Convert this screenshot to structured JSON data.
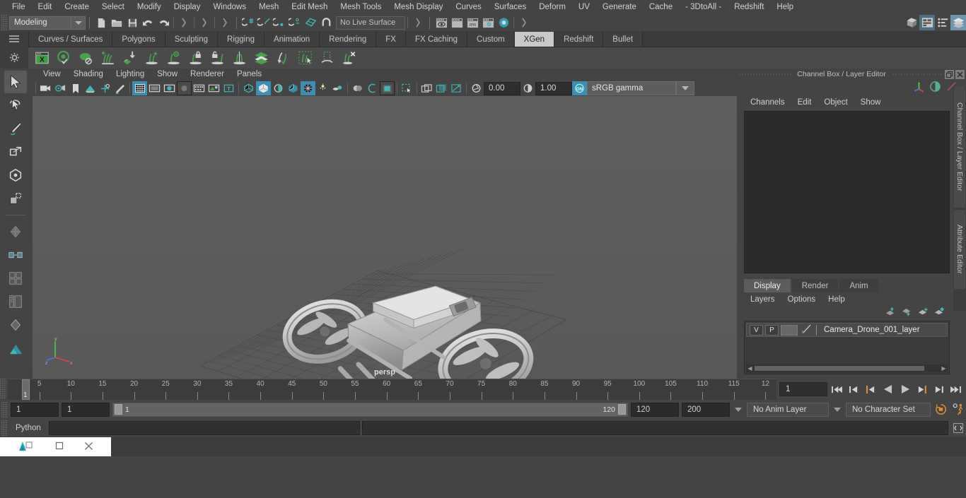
{
  "menubar": {
    "items": [
      "File",
      "Edit",
      "Create",
      "Select",
      "Modify",
      "Display",
      "Windows",
      "Mesh",
      "Edit Mesh",
      "Mesh Tools",
      "Mesh Display",
      "Curves",
      "Surfaces",
      "Deform",
      "UV",
      "Generate",
      "Cache",
      "- 3DtoAll -",
      "Redshift",
      "Help"
    ]
  },
  "statusline": {
    "mode": "Modeling",
    "live_surface": "No Live Surface",
    "num1": "0.00",
    "num2": "1.00",
    "colorspace": "sRGB gamma"
  },
  "shelf": {
    "tabs": [
      "Curves / Surfaces",
      "Polygons",
      "Sculpting",
      "Rigging",
      "Animation",
      "Rendering",
      "FX",
      "FX Caching",
      "Custom",
      "XGen",
      "Redshift",
      "Bullet"
    ],
    "active_tab": "XGen",
    "icons": [
      "xgen-editor-icon",
      "xgen-preview-visible-icon",
      "xgen-preview-hidden-icon",
      "xgen-add-description-icon",
      "xgen-import-collection-icon",
      "xgen-grow-guide-icon",
      "xgen-guide-visibility-icon",
      "xgen-lock-guide-icon",
      "xgen-unlock-guide-icon",
      "xgen-mirror-guide-icon",
      "xgen-layers-icon",
      "xgen-convert-guide-icon",
      "xgen-select-primitives-icon",
      "xgen-region-mask-icon",
      "xgen-delete-guide-icon"
    ]
  },
  "toolbox": {
    "tools": [
      "select-tool",
      "lasso-select-tool",
      "paint-select-tool",
      "move-tool",
      "rotate-tool",
      "scale-tool",
      "last-tool",
      "layout-single-icon",
      "layout-two-pane-icon",
      "layout-four-pane-icon",
      "layout-persp-outliner-icon",
      "layout-hypershade-icon",
      "layout-home-icon"
    ]
  },
  "viewport": {
    "menu": [
      "View",
      "Shading",
      "Lighting",
      "Show",
      "Renderer",
      "Panels"
    ],
    "camera_label": "persp",
    "axis": {
      "x": "x",
      "y": "y",
      "z": "z"
    },
    "toolbar_icons": [
      "camera-icon",
      "camera-attributes-icon",
      "bookmark-icon",
      "image-plane-icon",
      "2d-pan-zoom-icon",
      "grease-pencil-icon",
      "wireframe-icon",
      "smooth-shade-all-icon",
      "smooth-shade-selected-icon",
      "flat-shade-icon",
      "shaded-textured-icon",
      "use-default-material-icon",
      "xray-icon",
      "wireframe-on-shaded-icon",
      "xray-joints-icon",
      "lighting-icon",
      "shadows-icon",
      "screen-space-ao-icon",
      "motion-blur-icon",
      "multisample-icon",
      "isolate-select-icon",
      "grid-icon",
      "film-gate-icon",
      "resolution-gate-icon",
      "gate-mask-icon",
      "exposure-icon",
      "gamma-icon",
      "color-management-icon"
    ]
  },
  "channelbox": {
    "title": "Channel Box / Layer Editor",
    "menu": [
      "Channels",
      "Edit",
      "Object",
      "Show"
    ],
    "tool_icons": [
      "manipulator-icon",
      "channelbox-toggle-icon",
      "attribute-editor-icon"
    ],
    "window_buttons": [
      "restore-icon",
      "close-icon"
    ],
    "vertical_tabs": [
      "Channel Box / Layer Editor",
      "Attribute Editor"
    ]
  },
  "layereditor": {
    "tabs": [
      "Display",
      "Render",
      "Anim"
    ],
    "active_tab": "Display",
    "menu": [
      "Layers",
      "Options",
      "Help"
    ],
    "arrow_icons": [
      "move-layer-up-icon",
      "move-layer-down-icon",
      "new-layer-icon",
      "new-layer-from-selected-icon"
    ],
    "layers": [
      {
        "visibility": "V",
        "playback": "P",
        "shading": "",
        "name": "Camera_Drone_001_layer"
      }
    ]
  },
  "timeslider": {
    "ticks": [
      "5",
      "10",
      "15",
      "20",
      "25",
      "30",
      "35",
      "40",
      "45",
      "50",
      "55",
      "60",
      "65",
      "70",
      "75",
      "80",
      "85",
      "90",
      "95",
      "100",
      "105",
      "110",
      "115",
      "12"
    ],
    "current_marker": "1",
    "current_frame": "1",
    "playback_buttons": [
      "go-to-start-icon",
      "step-back-keyframe-icon",
      "step-back-frame-icon",
      "play-backwards-icon",
      "play-forwards-icon",
      "step-forward-frame-icon",
      "step-forward-keyframe-icon",
      "go-to-end-icon"
    ]
  },
  "rangeslider": {
    "anim_start": "1",
    "range_start": "1",
    "bar_start": "1",
    "bar_end": "120",
    "range_end": "120",
    "anim_end": "200",
    "anim_layer": "No Anim Layer",
    "character_set": "No Character Set",
    "icons": [
      "auto-keyframe-icon",
      "animation-preferences-icon"
    ]
  },
  "commandline": {
    "language": "Python",
    "input_value": "",
    "output_value": "",
    "icon": "script-editor-icon"
  },
  "taskbar": {
    "buttons": [
      "maya-app-icon",
      "maximize-icon",
      "close-icon"
    ]
  },
  "colors": {
    "accent_blue": "#3b8fb5",
    "accent_green": "#4a9a4a",
    "accent_orange": "#e08a33",
    "panel_bg": "#444444",
    "viewport_bg": "#5c5c5c",
    "active_tab": "#c9c9c9"
  }
}
